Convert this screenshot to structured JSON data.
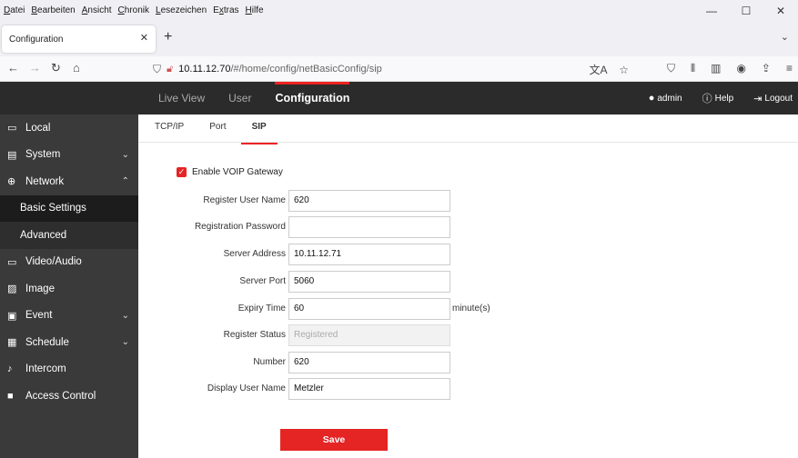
{
  "menubar": [
    {
      "pre": "",
      "u": "D",
      "post": "atei"
    },
    {
      "pre": "",
      "u": "B",
      "post": "earbeiten"
    },
    {
      "pre": "",
      "u": "A",
      "post": "nsicht"
    },
    {
      "pre": "",
      "u": "C",
      "post": "hronik"
    },
    {
      "pre": "",
      "u": "L",
      "post": "esezeichen"
    },
    {
      "pre": "E",
      "u": "x",
      "post": "tras"
    },
    {
      "pre": "",
      "u": "H",
      "post": "ilfe"
    }
  ],
  "window_controls": {
    "minimize": "—",
    "maximize": "☐",
    "close": "✕"
  },
  "browser_tab": {
    "title": "Configuration",
    "close": "✕",
    "new": "+",
    "list": "⌄"
  },
  "url": {
    "host": "10.11.12.70",
    "path": "/#/home/config/netBasicConfig/sip"
  },
  "app_nav": {
    "items": [
      "Live View",
      "User",
      "Configuration"
    ],
    "active": "Configuration",
    "admin": "admin",
    "help": "Help",
    "logout": "Logout"
  },
  "sidebar": {
    "local": "Local",
    "system": "System",
    "network": "Network",
    "basic_settings": "Basic Settings",
    "advanced": "Advanced",
    "video_audio": "Video/Audio",
    "image": "Image",
    "event": "Event",
    "schedule": "Schedule",
    "intercom": "Intercom",
    "access_control": "Access Control"
  },
  "subtabs": {
    "tcpip": "TCP/IP",
    "port": "Port",
    "sip": "SIP"
  },
  "form": {
    "enable_voip": "Enable VOIP Gateway",
    "enable_voip_checked": true,
    "register_user_name": {
      "label": "Register User Name",
      "value": "620"
    },
    "registration_password": {
      "label": "Registration Password",
      "value": ""
    },
    "server_address": {
      "label": "Server Address",
      "value": "10.11.12.71"
    },
    "server_port": {
      "label": "Server Port",
      "value": "5060"
    },
    "expiry_time": {
      "label": "Expiry Time",
      "value": "60",
      "unit": "minute(s)"
    },
    "register_status": {
      "label": "Register Status",
      "value": "Registered"
    },
    "number": {
      "label": "Number",
      "value": "620"
    },
    "display_user_name": {
      "label": "Display User Name",
      "value": "Metzler"
    },
    "save": "Save"
  },
  "colors": {
    "accent": "#e52424",
    "header": "#2b2b2b",
    "sidebar": "#3a3a3a"
  }
}
